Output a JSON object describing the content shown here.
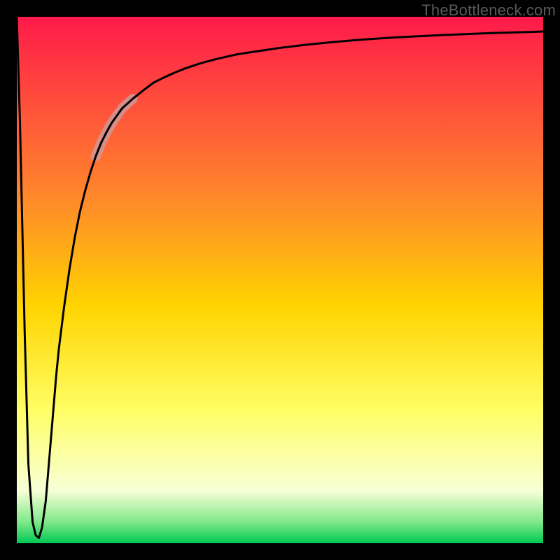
{
  "watermark": "TheBottleneck.com",
  "colors": {
    "frame": "#000000",
    "watermark_text": "#5a5a5a",
    "curve": "#000000",
    "highlight": "#cf9898",
    "gradient_top": "#ff1a4a",
    "gradient_mid1": "#ff8a2a",
    "gradient_mid2": "#ffd400",
    "gradient_mid3": "#ffff66",
    "gradient_mid4": "#f7ffd6",
    "gradient_mid5": "#7fe88a",
    "gradient_bottom": "#00c853"
  },
  "chart_data": {
    "type": "line",
    "title": "",
    "xlabel": "",
    "ylabel": "",
    "xlim": [
      0,
      100
    ],
    "ylim": [
      0,
      100
    ],
    "grid": false,
    "legend": false,
    "x": [
      0.0,
      0.6,
      1.5,
      2.2,
      3.0,
      3.6,
      4.2,
      4.8,
      5.5,
      6.0,
      6.5,
      7.0,
      7.5,
      8.0,
      9.0,
      10.0,
      11.0,
      12.0,
      13.0,
      14.0,
      15.0,
      16.0,
      17.0,
      18.0,
      20.0,
      22.0,
      24.0,
      26.0,
      28.0,
      30.0,
      32.0,
      35.0,
      38.0,
      42.0,
      46.0,
      50.0,
      55.0,
      60.0,
      66.0,
      72.0,
      80.0,
      90.0,
      100.0
    ],
    "values": [
      100.0,
      80.0,
      40.0,
      15.0,
      4.0,
      1.5,
      1.0,
      3.0,
      8.0,
      14.0,
      20.0,
      26.0,
      32.0,
      37.0,
      45.0,
      52.0,
      58.0,
      63.0,
      67.0,
      70.5,
      73.5,
      76.0,
      78.0,
      79.8,
      82.6,
      84.4,
      86.0,
      87.5,
      88.5,
      89.4,
      90.2,
      91.2,
      92.0,
      92.9,
      93.5,
      94.1,
      94.7,
      95.2,
      95.7,
      96.1,
      96.5,
      96.9,
      97.2
    ],
    "highlight_range_x": [
      15.0,
      22.0
    ]
  }
}
